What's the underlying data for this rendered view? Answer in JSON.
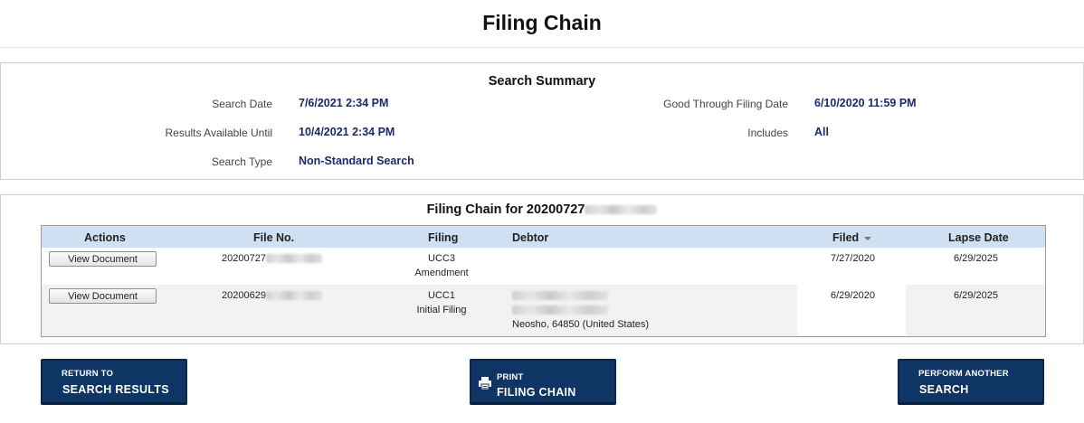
{
  "page_title": "Filing Chain",
  "summary": {
    "heading": "Search Summary",
    "search_date_label": "Search Date",
    "search_date": "7/6/2021 2:34 PM",
    "results_until_label": "Results Available Until",
    "results_until": "10/4/2021 2:34 PM",
    "search_type_label": "Search Type",
    "search_type": "Non-Standard Search",
    "good_through_label": "Good Through Filing Date",
    "good_through": "6/10/2020 11:59 PM",
    "includes_label": "Includes",
    "includes": "All"
  },
  "chain": {
    "heading_prefix": "Filing Chain for 20200727",
    "columns": {
      "actions": "Actions",
      "file_no": "File No.",
      "filing": "Filing",
      "debtor": "Debtor",
      "filed": "Filed",
      "lapse_date": "Lapse Date"
    },
    "rows": [
      {
        "action": "View Document",
        "file_no_prefix": "20200727",
        "filing_type": "UCC3",
        "filing_subtype": "Amendment",
        "filed": "7/27/2020",
        "lapse_date": "6/29/2025"
      },
      {
        "action": "View Document",
        "file_no_prefix": "20200629",
        "filing_type": "UCC1",
        "filing_subtype": "Initial Filing",
        "debtor_location": "Neosho, 64850 (United States)",
        "filed": "6/29/2020",
        "lapse_date": "6/29/2025"
      }
    ]
  },
  "buttons": {
    "return_small": "RETURN TO",
    "return_big": "SEARCH RESULTS",
    "print_small": "PRINT",
    "print_big": "FILING CHAIN",
    "perform_small": "PERFORM ANOTHER",
    "perform_big": "SEARCH"
  },
  "colors": {
    "button_bg": "#0f3565",
    "header_bg": "#cfe0f3",
    "value_text": "#1c2a6b"
  }
}
